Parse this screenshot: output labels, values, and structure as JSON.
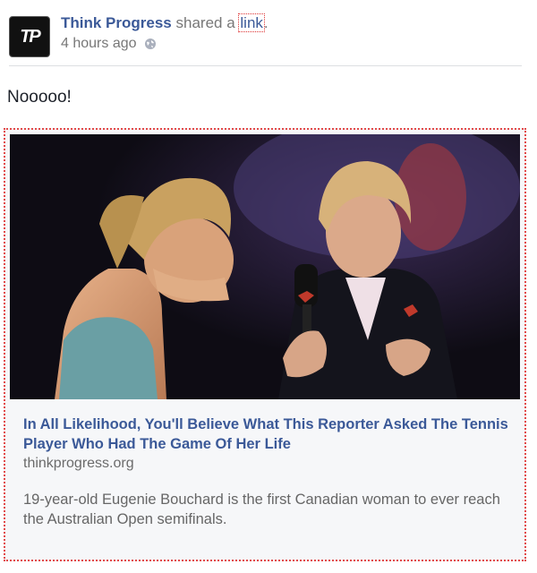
{
  "post": {
    "author": "Think Progress",
    "action": "shared a",
    "link_word": "link",
    "period": ".",
    "time": "4 hours ago",
    "avatar_text": "TP",
    "status_text": "Nooooo!"
  },
  "card": {
    "title": "In All Likelihood, You'll Believe What This Reporter Asked The Tennis Player Who Had The Game Of Her Life",
    "domain": "thinkprogress.org",
    "description": "19-year-old Eugenie Bouchard is the first Canadian woman to ever reach the Australian Open semifinals."
  },
  "colors": {
    "link": "#3b5998",
    "muted": "#777777",
    "card_bg": "#f6f7f9",
    "focus_outline": "#e24a4a"
  },
  "icons": {
    "privacy": "globe-icon"
  }
}
